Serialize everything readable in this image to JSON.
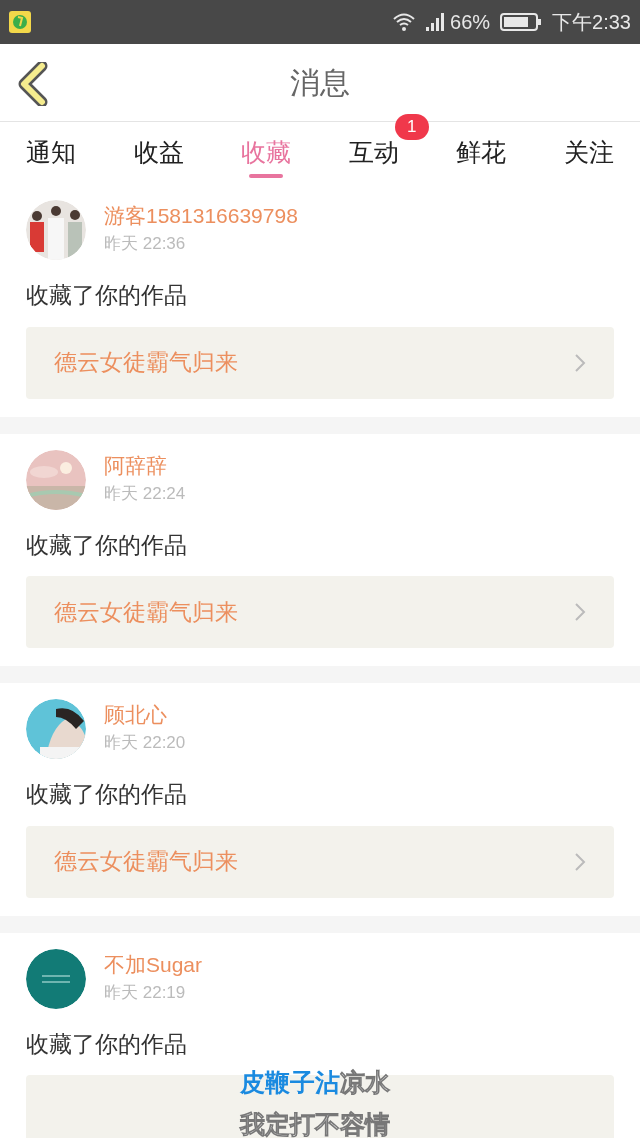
{
  "status_bar": {
    "battery": "66%",
    "time": "下午2:33"
  },
  "header": {
    "title": "消息"
  },
  "tabs": [
    {
      "label": "通知",
      "selected": false
    },
    {
      "label": "收益",
      "selected": false
    },
    {
      "label": "收藏",
      "selected": true
    },
    {
      "label": "互动",
      "selected": false,
      "badge": "1"
    },
    {
      "label": "鲜花",
      "selected": false
    },
    {
      "label": "关注",
      "selected": false
    }
  ],
  "messages": [
    {
      "user": "游客1581316639798",
      "time": "昨天 22:36",
      "action": "收藏了你的作品",
      "work": "德云女徒霸气归来"
    },
    {
      "user": "阿辞辞",
      "time": "昨天 22:24",
      "action": "收藏了你的作品",
      "work": "德云女徒霸气归来"
    },
    {
      "user": "顾北心",
      "time": "昨天 22:20",
      "action": "收藏了你的作品",
      "work": "德云女徒霸气归来"
    },
    {
      "user": "不加Sugar",
      "time": "昨天 22:19",
      "action": "收藏了你的作品"
    }
  ],
  "lyrics": {
    "lines": [
      {
        "parts": [
          {
            "text": "皮鞭子沾",
            "sung": true
          },
          {
            "text": "凉水",
            "sung": false
          }
        ]
      },
      {
        "parts": [
          {
            "text": "我定打不容情",
            "sung": false
          }
        ]
      }
    ]
  }
}
